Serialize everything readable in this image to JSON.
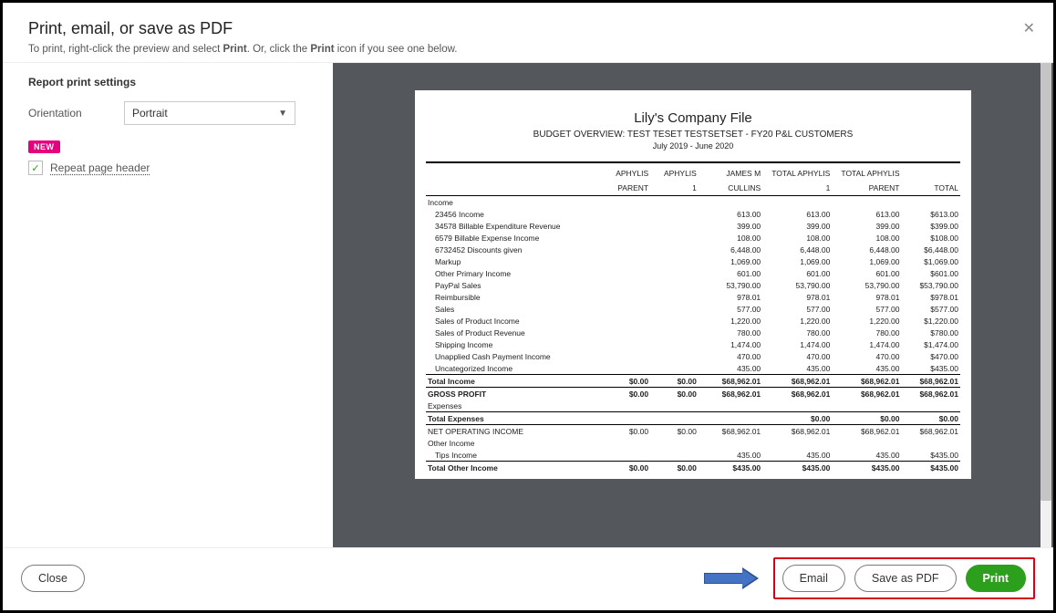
{
  "dialog": {
    "title": "Print, email, or save as PDF",
    "hint_pre": "To print, right-click the preview and select ",
    "hint_b1": "Print",
    "hint_mid": ". Or, click the ",
    "hint_b2": "Print",
    "hint_post": " icon if you see one below."
  },
  "settings": {
    "heading": "Report print settings",
    "orientation_label": "Orientation",
    "orientation_value": "Portrait",
    "new_badge": "NEW",
    "repeat_header_label": "Repeat page header",
    "repeat_header_checked": true
  },
  "report": {
    "company": "Lily's Company File",
    "subtitle": "BUDGET OVERVIEW: TEST TESET TESTSETSET - FY20 P&L  CUSTOMERS",
    "date_range": "July 2019 - June 2020",
    "columns": [
      "",
      "APHYLIS PARENT",
      "APHYLIS 1",
      "JAMES M CULLINS",
      "TOTAL APHYLIS 1",
      "TOTAL APHYLIS PARENT",
      "TOTAL"
    ],
    "rows": [
      {
        "type": "section",
        "cells": [
          "Income",
          "",
          "",
          "",
          "",
          "",
          ""
        ]
      },
      {
        "type": "indent",
        "cells": [
          "23456 Income",
          "",
          "",
          "613.00",
          "613.00",
          "613.00",
          "$613.00"
        ]
      },
      {
        "type": "indent",
        "cells": [
          "34578 Billable Expenditure Revenue",
          "",
          "",
          "399.00",
          "399.00",
          "399.00",
          "$399.00"
        ]
      },
      {
        "type": "indent",
        "cells": [
          "6579 Billable Expense Income",
          "",
          "",
          "108.00",
          "108.00",
          "108.00",
          "$108.00"
        ]
      },
      {
        "type": "indent",
        "cells": [
          "6732452 Discounts given",
          "",
          "",
          "6,448.00",
          "6,448.00",
          "6,448.00",
          "$6,448.00"
        ]
      },
      {
        "type": "indent",
        "cells": [
          "Markup",
          "",
          "",
          "1,069.00",
          "1,069.00",
          "1,069.00",
          "$1,069.00"
        ]
      },
      {
        "type": "indent",
        "cells": [
          "Other Primary Income",
          "",
          "",
          "601.00",
          "601.00",
          "601.00",
          "$601.00"
        ]
      },
      {
        "type": "indent",
        "cells": [
          "PayPal Sales",
          "",
          "",
          "53,790.00",
          "53,790.00",
          "53,790.00",
          "$53,790.00"
        ]
      },
      {
        "type": "indent",
        "cells": [
          "Reimbursible",
          "",
          "",
          "978.01",
          "978.01",
          "978.01",
          "$978.01"
        ]
      },
      {
        "type": "indent",
        "cells": [
          "Sales",
          "",
          "",
          "577.00",
          "577.00",
          "577.00",
          "$577.00"
        ]
      },
      {
        "type": "indent",
        "cells": [
          "Sales of Product Income",
          "",
          "",
          "1,220.00",
          "1,220.00",
          "1,220.00",
          "$1,220.00"
        ]
      },
      {
        "type": "indent",
        "cells": [
          "Sales of Product Revenue",
          "",
          "",
          "780.00",
          "780.00",
          "780.00",
          "$780.00"
        ]
      },
      {
        "type": "indent",
        "cells": [
          "Shipping Income",
          "",
          "",
          "1,474.00",
          "1,474.00",
          "1,474.00",
          "$1,474.00"
        ]
      },
      {
        "type": "indent",
        "cells": [
          "Unapplied Cash Payment Income",
          "",
          "",
          "470.00",
          "470.00",
          "470.00",
          "$470.00"
        ]
      },
      {
        "type": "indent",
        "cells": [
          "Uncategorized Income",
          "",
          "",
          "435.00",
          "435.00",
          "435.00",
          "$435.00"
        ]
      },
      {
        "type": "total",
        "cells": [
          "Total Income",
          "$0.00",
          "$0.00",
          "$68,962.01",
          "$68,962.01",
          "$68,962.01",
          "$68,962.01"
        ]
      },
      {
        "type": "total",
        "cells": [
          "GROSS PROFIT",
          "$0.00",
          "$0.00",
          "$68,962.01",
          "$68,962.01",
          "$68,962.01",
          "$68,962.01"
        ]
      },
      {
        "type": "section-plain",
        "cells": [
          "Expenses",
          "",
          "",
          "",
          "",
          "",
          ""
        ]
      },
      {
        "type": "total",
        "cells": [
          "Total Expenses",
          "",
          "",
          "",
          "$0.00",
          "$0.00",
          "$0.00"
        ]
      },
      {
        "type": "total-plain",
        "cells": [
          "NET OPERATING INCOME",
          "$0.00",
          "$0.00",
          "$68,962.01",
          "$68,962.01",
          "$68,962.01",
          "$68,962.01"
        ]
      },
      {
        "type": "section-plain",
        "cells": [
          "Other Income",
          "",
          "",
          "",
          "",
          "",
          ""
        ]
      },
      {
        "type": "indent",
        "cells": [
          "Tips Income",
          "",
          "",
          "435.00",
          "435.00",
          "435.00",
          "$435.00"
        ]
      },
      {
        "type": "total",
        "cells": [
          "Total Other Income",
          "$0.00",
          "$0.00",
          "$435.00",
          "$435.00",
          "$435.00",
          "$435.00"
        ]
      }
    ]
  },
  "footer": {
    "close": "Close",
    "email": "Email",
    "save_pdf": "Save as PDF",
    "print": "Print"
  }
}
